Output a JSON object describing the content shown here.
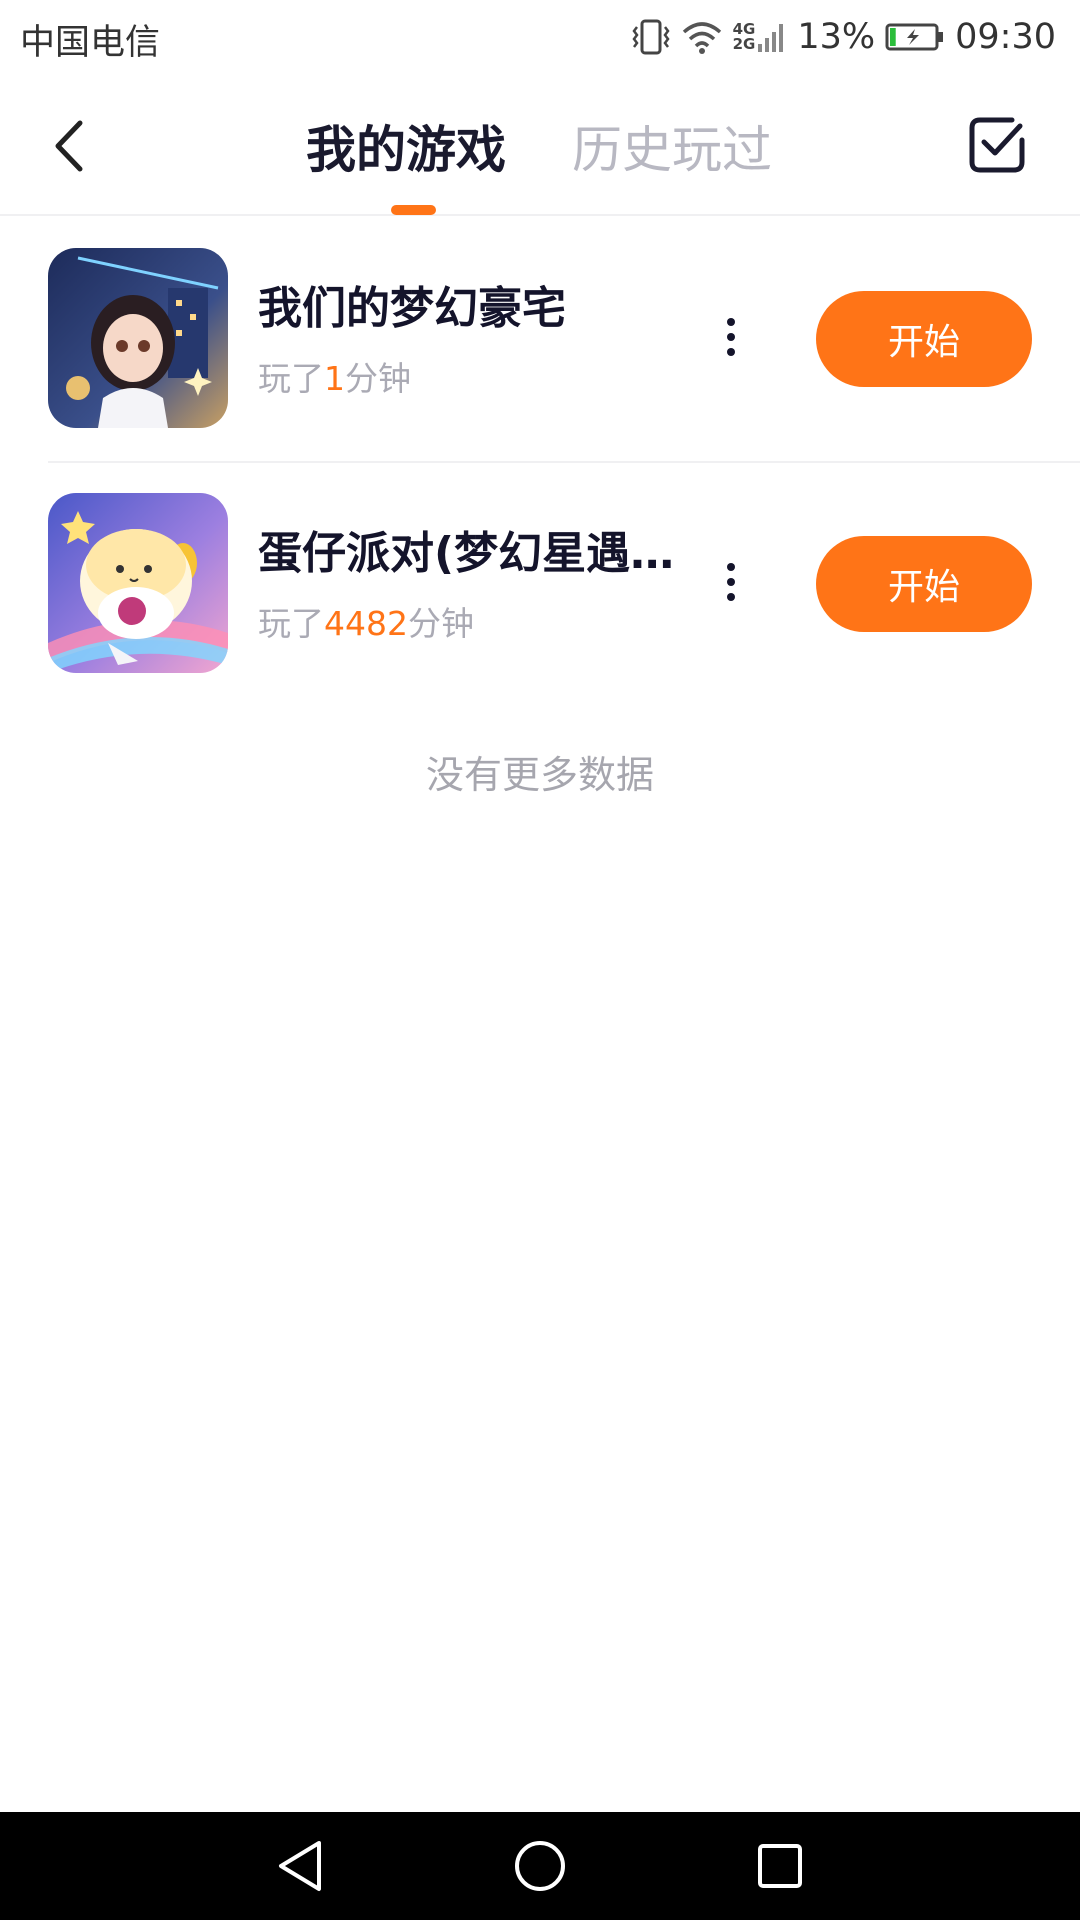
{
  "status_bar": {
    "carrier": "中国电信",
    "network_top": "4G",
    "network_bottom": "2G",
    "battery_percent": "13%",
    "time": "09:30",
    "icons": [
      "vibrate-icon",
      "wifi-icon",
      "signal-icon",
      "battery-charging-icon"
    ],
    "battery_level": 0.13
  },
  "header": {
    "tabs": [
      {
        "label": "我的游戏",
        "active": true
      },
      {
        "label": "历史玩过",
        "active": false
      }
    ],
    "back_icon": "chevron-left-icon",
    "select_icon": "checkbox-checked-icon"
  },
  "games": [
    {
      "title": "我们的梦幻豪宅",
      "played_prefix": "玩了",
      "played_minutes": "1",
      "played_suffix": "分钟",
      "start_label": "开始"
    },
    {
      "title": "蛋仔派对(梦幻星遇...",
      "played_prefix": "玩了",
      "played_minutes": "4482",
      "played_suffix": "分钟",
      "start_label": "开始"
    }
  ],
  "footer_text": "没有更多数据",
  "nav_bar": {
    "icons": [
      "back-triangle-icon",
      "home-circle-icon",
      "recents-square-icon"
    ]
  },
  "colors": {
    "accent": "#ff7417",
    "title_text": "#14142b",
    "muted_text": "#aaaab4",
    "divider": "#f0f0f2"
  }
}
